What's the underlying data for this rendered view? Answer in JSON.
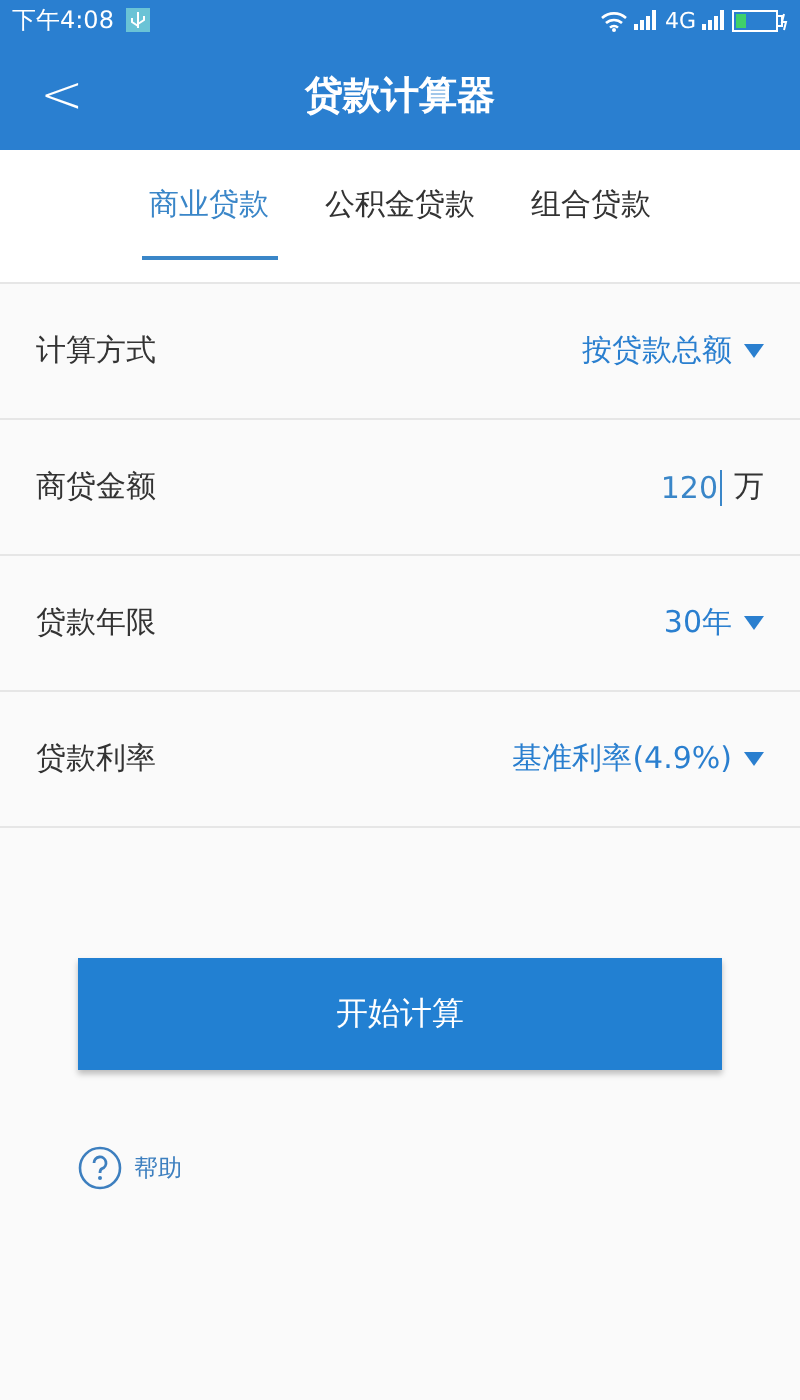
{
  "status_bar": {
    "time": "下午4:08",
    "network": "4G"
  },
  "header": {
    "title": "贷款计算器",
    "back": "<"
  },
  "tabs": [
    {
      "label": "商业贷款",
      "selected": true
    },
    {
      "label": "公积金贷款",
      "selected": false
    },
    {
      "label": "组合贷款",
      "selected": false
    }
  ],
  "rows": [
    {
      "kind": "select",
      "label": "计算方式",
      "value": "按贷款总额"
    },
    {
      "kind": "input",
      "label": "商贷金额",
      "value": "120",
      "unit": "万"
    },
    {
      "kind": "select",
      "label": "贷款年限",
      "value": "30年"
    },
    {
      "kind": "select",
      "label": "贷款利率",
      "value": "基准利率(4.9%)"
    }
  ],
  "button": "开始计算",
  "help": "帮助"
}
